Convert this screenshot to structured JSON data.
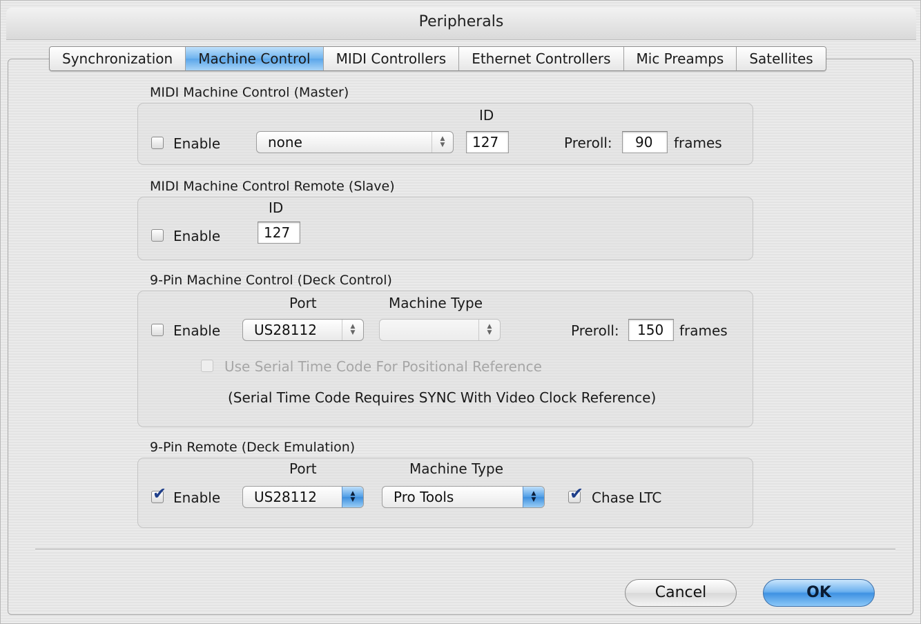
{
  "window": {
    "title": "Peripherals"
  },
  "tabs": [
    {
      "label": "Synchronization",
      "active": false
    },
    {
      "label": "Machine Control",
      "active": true
    },
    {
      "label": "MIDI Controllers",
      "active": false
    },
    {
      "label": "Ethernet Controllers",
      "active": false
    },
    {
      "label": "Mic Preamps",
      "active": false
    },
    {
      "label": "Satellites",
      "active": false
    }
  ],
  "mmc_master": {
    "title": "MIDI Machine Control (Master)",
    "enable_label": "Enable",
    "enabled": false,
    "device": "none",
    "id_label": "ID",
    "id_value": "127",
    "preroll_label": "Preroll:",
    "preroll_value": "90",
    "preroll_unit": "frames"
  },
  "mmc_remote": {
    "title": "MIDI Machine Control Remote (Slave)",
    "enable_label": "Enable",
    "enabled": false,
    "id_label": "ID",
    "id_value": "127"
  },
  "ninepin_control": {
    "title": "9-Pin Machine Control (Deck Control)",
    "enable_label": "Enable",
    "enabled": false,
    "port_label": "Port",
    "port_value": "US28112",
    "machine_type_label": "Machine Type",
    "machine_type_value": "",
    "preroll_label": "Preroll:",
    "preroll_value": "150",
    "preroll_unit": "frames",
    "serial_tc_label": "Use Serial Time Code For Positional Reference",
    "serial_tc_checked": false,
    "note": "(Serial Time Code Requires SYNC With Video Clock Reference)"
  },
  "ninepin_remote": {
    "title": "9-Pin Remote (Deck Emulation)",
    "enable_label": "Enable",
    "enabled": true,
    "port_label": "Port",
    "port_value": "US28112",
    "machine_type_label": "Machine Type",
    "machine_type_value": "Pro Tools",
    "chase_ltc_label": "Chase LTC",
    "chase_ltc_checked": true
  },
  "buttons": {
    "cancel": "Cancel",
    "ok": "OK"
  },
  "colors": {
    "accent": "#5aa6ea",
    "check": "#1f3f8a"
  }
}
